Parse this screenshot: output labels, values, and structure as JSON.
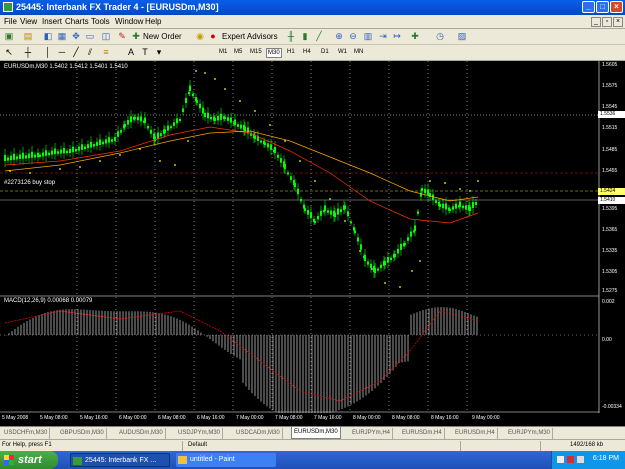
{
  "window": {
    "title": "25445: Interbank FX Trader 4 - [EURUSDm,M30]"
  },
  "menu": [
    "File",
    "View",
    "Insert",
    "Charts",
    "Tools",
    "Window",
    "Help"
  ],
  "toolbar": {
    "new_order": "New Order",
    "expert_advisors": "Expert Advisors",
    "timeframes": [
      "M1",
      "M5",
      "M15",
      "M30",
      "H1",
      "H4",
      "D1",
      "W1",
      "MN"
    ],
    "active_timeframe": "M30"
  },
  "chart": {
    "symbol_label": "EURUSDm,M30  1.5402  1.5412  1.5401  1.5410",
    "order_label": "#2273126 buy stop",
    "macd_label": "MACD(12,26,9) 0.00068 0.00079",
    "price_ticks": [
      "1.5605",
      "1.5575",
      "1.5545",
      "1.5515",
      "1.5485",
      "1.5455",
      "1.5395",
      "1.5365",
      "1.5335",
      "1.5305",
      "1.5275"
    ],
    "price_badges": {
      "upper": "1.5536",
      "order": "1.5424",
      "current": "1.5410"
    },
    "macd_ticks": [
      "0.002",
      "0.00",
      "-0.00334"
    ],
    "time_ticks": [
      "5 May 2008",
      "5 May 08:00",
      "5 May 16:00",
      "6 May 00:00",
      "6 May 08:00",
      "6 May 16:00",
      "7 May 00:00",
      "7 May 08:00",
      "7 May 16:00",
      "8 May 00:00",
      "8 May 08:00",
      "8 May 16:00",
      "9 May 00:00"
    ],
    "colors": {
      "background": "#000000",
      "candles": "#00ff00",
      "macd_histogram": "#c0c0c0",
      "macd_signal": "#ff0000",
      "ma_fast": "#ff3300",
      "ma_slow": "#ffa500",
      "psar": "#ffff00"
    }
  },
  "tabs": [
    "USDCHFm,M30",
    "GBPUSDm,M30",
    "AUDUSDm,M30",
    "USDJPYm,M30",
    "USDCADm,M30",
    "EURUSDm,M30",
    "EURJPYm,H4",
    "EURUSDm,H4",
    "EURUSDm,H4",
    "EURJPYm,M30"
  ],
  "active_tab": "EURUSDm,M30",
  "status": {
    "help": "For Help, press F1",
    "profile": "Default",
    "traffic": "1492/168 kb"
  },
  "taskbar": {
    "start": "start",
    "tasks": [
      "25445: Interbank FX ...",
      "untitled - Paint"
    ],
    "clock": "6:18 PM"
  }
}
